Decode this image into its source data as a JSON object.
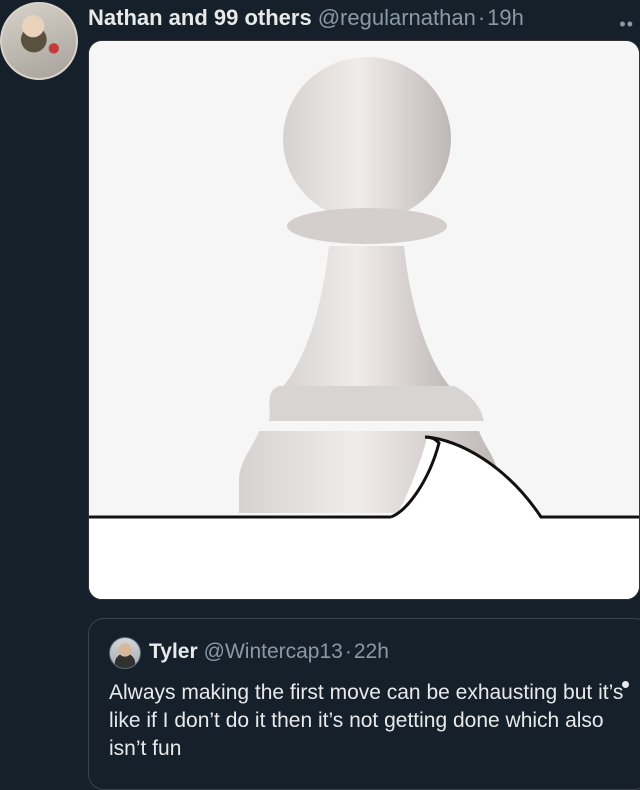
{
  "post": {
    "author": "Nathan and 99 others",
    "handle": "@regularnathan",
    "separator": "·",
    "time": "19h",
    "more_icon": "more-dots-icon",
    "media_alt": "white-pawn-chess-piece-with-speech-bubble-tail"
  },
  "quote": {
    "author": "Tyler",
    "handle": "@Wintercap13",
    "separator": "·",
    "time": "22h",
    "text": "Always making the first move can be exhausting but it’s like if I don’t do it then it’s not getting done which also isn’t fun"
  },
  "colors": {
    "background": "#15202b",
    "text": "#e7e9ea",
    "secondary_text": "#8b98a5",
    "border": "#38444d"
  }
}
